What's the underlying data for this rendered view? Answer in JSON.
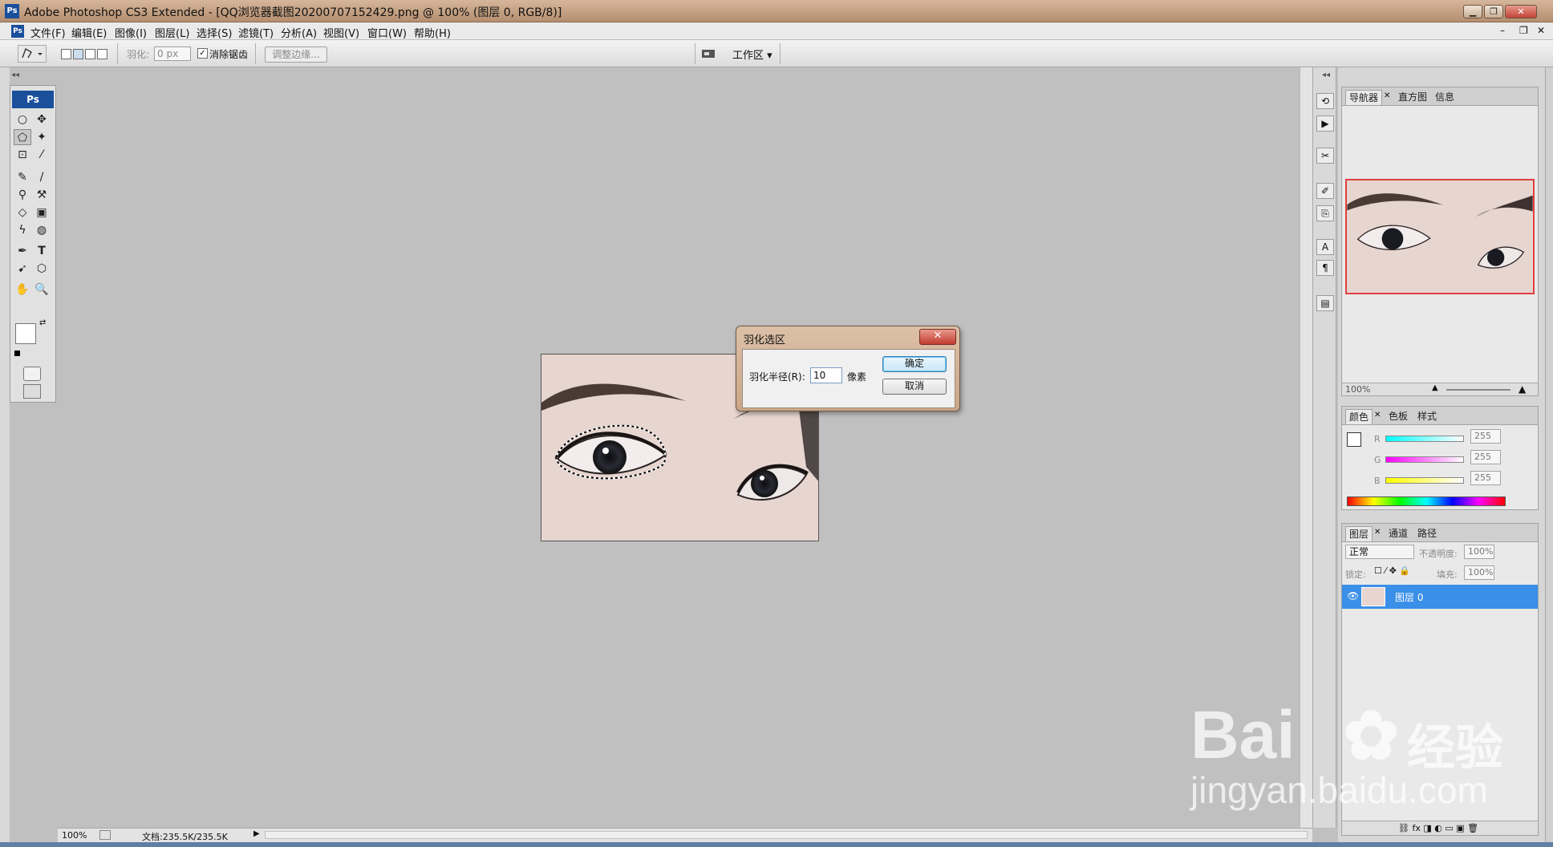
{
  "window": {
    "title": "Adobe Photoshop CS3 Extended - [QQ浏览器截图20200707152429.png @ 100% (图层 0, RGB/8)]",
    "app_badge": "Ps",
    "controls": {
      "minimize": "▁",
      "restore": "❐",
      "close": "✕"
    }
  },
  "menu": {
    "items": [
      "文件(F)",
      "编辑(E)",
      "图像(I)",
      "图层(L)",
      "选择(S)",
      "滤镜(T)",
      "分析(A)",
      "视图(V)",
      "窗口(W)",
      "帮助(H)"
    ],
    "doc_controls": {
      "minimize": "–",
      "restore": "❐",
      "close": "✕"
    }
  },
  "options": {
    "feather_label": "羽化:",
    "feather_value": "0 px",
    "antialias_label": "消除锯齿",
    "antialias_checked": true,
    "refine_edge": "调整边缘...",
    "workspace": "工作区 ▾"
  },
  "toolbox": {
    "badge": "Ps",
    "tools": [
      "○",
      "✥",
      "⬠",
      "✦",
      "⊡",
      "⁄",
      "✎",
      "/",
      "⚲",
      "⚒",
      "◇",
      "▣",
      "ϟ",
      "◍",
      "✒",
      "T",
      "➹",
      "⬡",
      "✋",
      "🔍"
    ]
  },
  "status": {
    "zoom": "100%",
    "doc_info": "文档:235.5K/235.5K"
  },
  "dialog": {
    "title": "羽化选区",
    "radius_label": "羽化半径(R):",
    "radius_value": "10",
    "unit": "像素",
    "ok": "确定",
    "cancel": "取消"
  },
  "navigator": {
    "tabs": [
      "导航器",
      "直方图",
      "信息"
    ],
    "zoom": "100%"
  },
  "color_panel": {
    "tabs": [
      "颜色",
      "色板",
      "样式"
    ],
    "channels": [
      {
        "label": "R",
        "value": "255"
      },
      {
        "label": "G",
        "value": "255"
      },
      {
        "label": "B",
        "value": "255"
      }
    ]
  },
  "layers_panel": {
    "tabs": [
      "图层",
      "通道",
      "路径"
    ],
    "blend_mode": "正常",
    "opacity_label": "不透明度:",
    "opacity_value": "100%",
    "lock_label": "锁定:",
    "fill_label": "填充:",
    "fill_value": "100%",
    "layer_name": "图层 0"
  },
  "watermark": {
    "brand": "Bai",
    "brand_tail": "经验",
    "url": "jingyan.baidu.com"
  }
}
